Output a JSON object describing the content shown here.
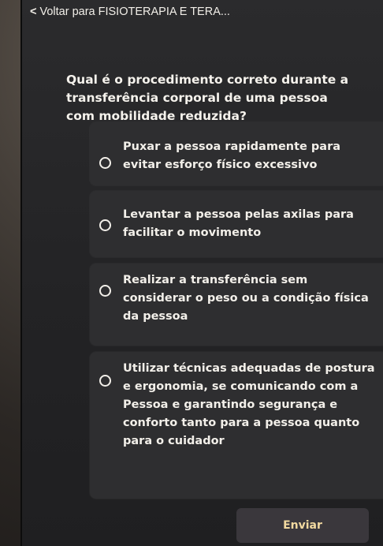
{
  "header": {
    "back_label": "Voltar para FISIOTERAPIA E TERA..."
  },
  "quiz": {
    "question": "Qual é o procedimento correto durante a transferência corporal de uma pessoa com mobilidade reduzida?",
    "options": [
      {
        "label": "Puxar a pessoa rapidamente para evitar esforço físico excessivo"
      },
      {
        "label": "Levantar a pessoa pelas axilas para facilitar o movimento"
      },
      {
        "label": "Realizar a transferência sem considerar o peso ou a condição física da pessoa"
      },
      {
        "label": "Utilizar técnicas adequadas de postura e ergonomia, se comunicando com a Pessoa e garantindo segurança e conforto tanto para a pessoa quanto para o cuidador"
      }
    ],
    "submit_label": "Enviar"
  },
  "colors": {
    "background": "#262628",
    "option_background": "#2e2e30",
    "text": "#f2efe9",
    "button_text": "#f2d9a0"
  },
  "icons": {
    "back": "chevron-left-icon",
    "option_marker": "radio-unselected-icon"
  }
}
